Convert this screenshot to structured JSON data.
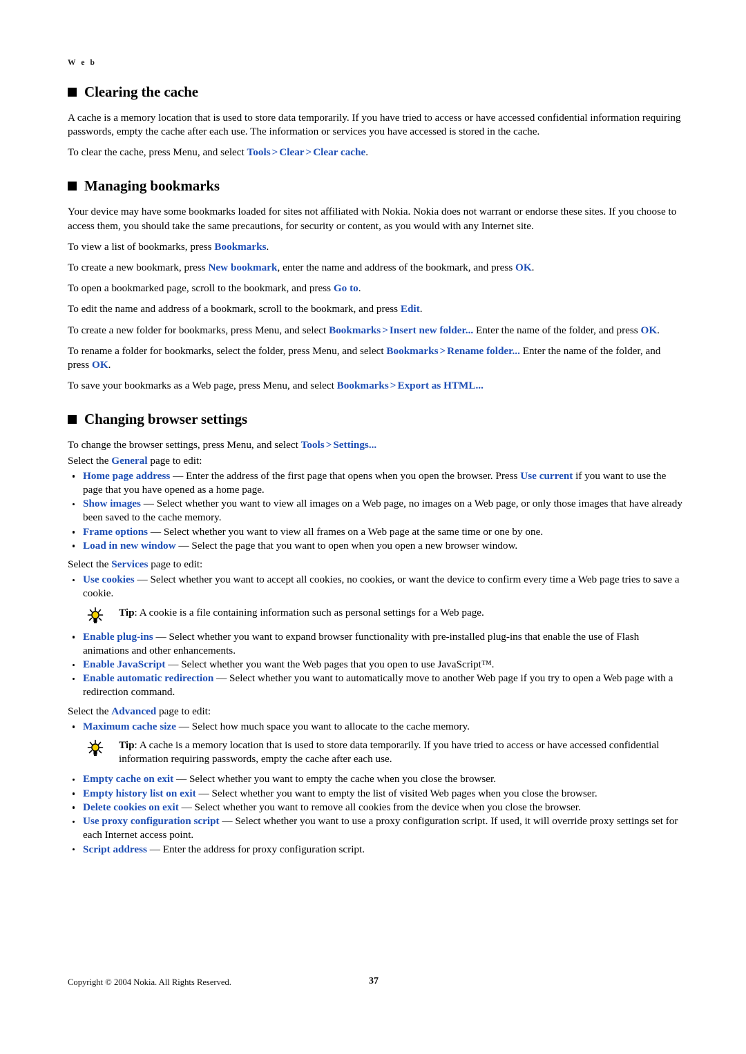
{
  "page": {
    "running_head": "W e b",
    "page_number": "37",
    "copyright": "Copyright © 2004 Nokia. All Rights Reserved.",
    "link_color": "#1f4fb5",
    "text_color": "#000000",
    "background_color": "#ffffff"
  },
  "sections": [
    {
      "id": "clearing-the-cache",
      "heading": "Clearing the cache",
      "paragraphs": [
        "A cache is a memory location that is used to store data temporarily. If you have tried to access or have accessed confidential information requiring passwords, empty the cache after each use. The information or services you have accessed is stored in the cache."
      ],
      "instruction": {
        "lead": "To clear the cache, press Menu, and select ",
        "links": [
          "Tools",
          "Clear",
          "Clear cache"
        ],
        "separator": ">",
        "trail": "."
      }
    },
    {
      "id": "managing-bookmarks",
      "heading": "Managing bookmarks",
      "intro": "Your device may have some bookmarks loaded for sites not affiliated with Nokia. Nokia does not warrant or endorse these sites. If you choose to access them, you should take the same precautions, for security or content, as you would with any Internet site.",
      "instructions": [
        {
          "a": "To view a list of bookmarks, press ",
          "l1": "Bookmarks",
          "b": ".",
          "l2": "",
          "c": "",
          "l3": "",
          "d": ""
        },
        {
          "a": "To create a new bookmark, press ",
          "l1": "New bookmark",
          "b": ", enter the name and address of the bookmark, and press ",
          "l2": "OK",
          "c": ".",
          "l3": "",
          "d": ""
        },
        {
          "a": "To open a bookmarked page, scroll to the bookmark, and press ",
          "l1": "Go to",
          "b": ".",
          "l2": "",
          "c": "",
          "l3": "",
          "d": ""
        },
        {
          "a": "To edit the name and address of a bookmark, scroll to the bookmark, and press ",
          "l1": "Edit",
          "b": ".",
          "l2": "",
          "c": "",
          "l3": "",
          "d": ""
        },
        {
          "a": "To create a new folder for bookmarks, press Menu, and select ",
          "l1": "Bookmarks",
          "sep": ">",
          "l2": "Insert new folder...",
          "b": " Enter the name of the folder, and press ",
          "l3": "OK",
          "d": "."
        },
        {
          "a": "To rename a folder for bookmarks, select the folder, press Menu, and select ",
          "l1": "Bookmarks",
          "sep": ">",
          "l2": "Rename folder...",
          "b": " Enter the name of the folder, and press ",
          "l3": "OK",
          "d": "."
        },
        {
          "a": "To save your bookmarks as a Web page, press Menu, and select ",
          "l1": "Bookmarks",
          "sep": ">",
          "l2": "Export as HTML...",
          "b": "",
          "l3": "",
          "d": ""
        }
      ]
    },
    {
      "id": "changing-browser-settings",
      "heading": "Changing browser settings",
      "lead": {
        "a": "To change the browser settings, press Menu, and select ",
        "l1": "Tools",
        "sep": ">",
        "l2": "Settings..."
      },
      "general_page": {
        "a": "Select the ",
        "link": "General",
        "b": " page to edit:"
      },
      "general_items": [
        {
          "term": "Home page address",
          "dash": " — ",
          "text_a": "Enter the address of the first page that opens when you open the browser. Press ",
          "link2": "Use current",
          "text_b": " if you want to use the page that you have opened as a home page."
        },
        {
          "term": "Show images",
          "dash": " — ",
          "text_a": "Select whether you want to view all images on a Web page, no images on a Web page, or only those images that have already been saved to the cache memory.",
          "link2": "",
          "text_b": ""
        },
        {
          "term": "Frame options",
          "dash": " — ",
          "text_a": "Select whether you want to view all frames on a Web page at the same time or one by one.",
          "link2": "",
          "text_b": ""
        },
        {
          "term": "Load in new window",
          "dash": " — ",
          "text_a": "Select the page that you want to open when you open a new browser window.",
          "link2": "",
          "text_b": ""
        }
      ],
      "services_page": {
        "a": "Select the ",
        "link": "Services",
        "b": " page to edit:"
      },
      "services_items_before_tip": [
        {
          "term": "Use cookies",
          "dash": " — ",
          "text_a": "Select whether you want to accept all cookies, no cookies, or want the device to confirm every time a Web page tries to save a cookie.",
          "link2": "",
          "text_b": ""
        }
      ],
      "services_tip": {
        "icon": "lightbulb-tip-icon",
        "label": "Tip",
        "text": ": A cookie is a file containing information such as personal settings for a Web page."
      },
      "services_items_after_tip": [
        {
          "term": "Enable plug-ins",
          "dash": " — ",
          "text_a": "Select whether you want to expand browser functionality with pre-installed plug-ins that enable the use of Flash animations and other enhancements.",
          "link2": "",
          "text_b": ""
        },
        {
          "term": "Enable JavaScript",
          "dash": " — ",
          "text_a": "Select whether you want the Web pages that you open to use JavaScript™.",
          "link2": "",
          "text_b": ""
        },
        {
          "term": "Enable automatic redirection",
          "dash": " — ",
          "text_a": "Select whether you want to automatically move to another Web page if you try to open a Web page with a redirection command.",
          "link2": "",
          "text_b": ""
        }
      ],
      "advanced_page": {
        "a": "Select the ",
        "link": "Advanced",
        "b": " page to edit:"
      },
      "advanced_items_before_tip": [
        {
          "term": "Maximum cache size",
          "dash": " — ",
          "text_a": "Select how much space you want to allocate to the cache memory.",
          "link2": "",
          "text_b": ""
        }
      ],
      "advanced_tip": {
        "icon": "lightbulb-tip-icon",
        "label": "Tip",
        "text": ": A cache is a memory location that is used to store data temporarily. If you have tried to access or have accessed confidential information requiring passwords, empty the cache after each use."
      },
      "advanced_items_after_tip": [
        {
          "term": "Empty cache on exit",
          "dash": " — ",
          "text_a": "Select whether you want to empty the cache when you close the browser.",
          "link2": "",
          "text_b": ""
        },
        {
          "term": "Empty history list on exit",
          "dash": " — ",
          "text_a": "Select whether you want to empty the list of visited Web pages when you close the browser.",
          "link2": "",
          "text_b": ""
        },
        {
          "term": "Delete cookies on exit",
          "dash": " — ",
          "text_a": "Select whether you want to remove all cookies from the device when you close the browser.",
          "link2": "",
          "text_b": ""
        },
        {
          "term": "Use proxy configuration script",
          "dash": " — ",
          "text_a": "Select whether you want to use a proxy configuration script. If used, it will override proxy settings set for each Internet access point.",
          "link2": "",
          "text_b": ""
        },
        {
          "term": "Script address",
          "dash": " — ",
          "text_a": "Enter the address for proxy configuration script.",
          "link2": "",
          "text_b": ""
        }
      ]
    }
  ]
}
